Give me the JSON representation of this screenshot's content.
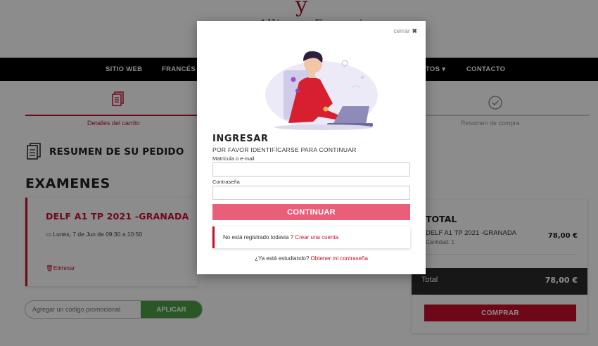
{
  "brand": {
    "mark": "y",
    "name": "Alliance Française"
  },
  "nav": {
    "items": [
      "SITIO WEB",
      "FRANCÉS",
      "TOS",
      "CONTACTO"
    ]
  },
  "steps": {
    "cart_label": "Detalles del carrito",
    "summary_label": "Resumen de compra"
  },
  "order": {
    "title": "RESUMEN DE SU PEDIDO",
    "section": "EXAMENES",
    "exam_name": "DELF A1 TP 2021 -GRANADA",
    "exam_date": "Lunes, 7 de Jun de 09:30 a 10:50",
    "remove_label": "Eliminar"
  },
  "promo": {
    "placeholder": "Agregar un código promocional",
    "button": "APLICAR"
  },
  "totals": {
    "heading": "TOTAL",
    "item_name": "DELF A1 TP 2021 -GRANADA",
    "item_qty": "Cantidad: 1",
    "item_price": "78,00 €",
    "total_label": "Total",
    "total_value": "78,00 €",
    "buy_button": "COMPRAR"
  },
  "modal": {
    "close_label": "cerrar",
    "title": "INGRESAR",
    "subtitle": "POR FAVOR IDENTIFÍCARSE PARA CONTINUAR",
    "user_label": "Matrícula o e-mail",
    "password_label": "Contraseña",
    "continue_button": "CONTINUAR",
    "register_text": "No está registrado todavia ?",
    "register_link": "Crear una cuenta",
    "password_text": "¿Ya está estudiando?",
    "password_link": "Obtener mi contraseña"
  },
  "colors": {
    "brand_red": "#c8102e",
    "continue_pink": "#e95f7a",
    "apply_green": "#4c9e46",
    "dark_bar": "#2b2b2b"
  }
}
